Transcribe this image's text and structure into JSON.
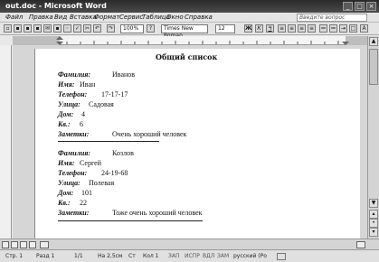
{
  "window": {
    "title": "out.doc - Microsoft Word"
  },
  "menu": {
    "items": [
      "Файл",
      "Правка",
      "Вид",
      "Вставка",
      "Формат",
      "Сервис",
      "Таблица",
      "Окно",
      "Справка"
    ],
    "help_placeholder": "Введите вопрос"
  },
  "toolbar": {
    "zoom": "100%",
    "font_name": "Times New Roman",
    "font_size": "12"
  },
  "document": {
    "title": "Общий список",
    "records": [
      {
        "fields": [
          {
            "label": "Фамилия:",
            "value": "Иванов"
          },
          {
            "label": "Имя:",
            "value": "Иван"
          },
          {
            "label": "Телефон:",
            "value": "17-17-17"
          },
          {
            "label": "Улица:",
            "value": "Садовая"
          },
          {
            "label": "Дом:",
            "value": "4"
          },
          {
            "label": "Кв.:",
            "value": "6"
          },
          {
            "label": "Заметки:",
            "value": "Очень хороший человек"
          }
        ]
      },
      {
        "fields": [
          {
            "label": "Фамилия:",
            "value": "Козлов"
          },
          {
            "label": "Имя:",
            "value": "Сергей"
          },
          {
            "label": "Телефон:",
            "value": "24-19-68"
          },
          {
            "label": "Улица:",
            "value": "Полевая"
          },
          {
            "label": "Дом:",
            "value": "101"
          },
          {
            "label": "Кв.:",
            "value": "22"
          },
          {
            "label": "Заметки:",
            "value": "Тоже очень хороший человек"
          }
        ]
      }
    ]
  },
  "status": {
    "page": "Стр. 1",
    "section": "Разд 1",
    "pages": "1/1",
    "position": "На 2,5см",
    "line": "Ст",
    "column": "Кол 1",
    "zap": "ЗАП",
    "ispr": "ИСПР",
    "vdl": "ВДЛ",
    "zam": "ЗАМ",
    "language": "русский (Ро"
  }
}
